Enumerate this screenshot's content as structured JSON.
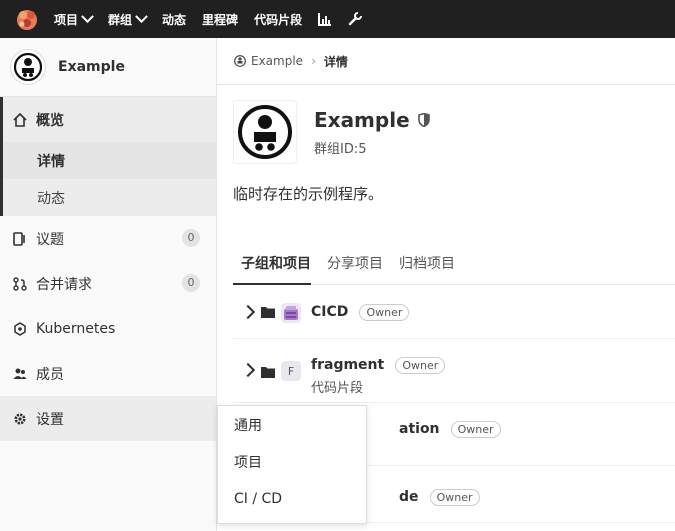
{
  "topnav": {
    "items": [
      {
        "label": "项目",
        "caret": true
      },
      {
        "label": "群组",
        "caret": true
      },
      {
        "label": "动态",
        "caret": false
      },
      {
        "label": "里程碑",
        "caret": false
      },
      {
        "label": "代码片段",
        "caret": false
      }
    ],
    "icons": [
      "chart-icon",
      "wrench-icon"
    ]
  },
  "sidebar": {
    "group_name": "Example",
    "overview_label": "概览",
    "overview_sub": [
      "详情",
      "动态"
    ],
    "items": [
      {
        "label": "议题",
        "icon": "issues-icon",
        "count": "0"
      },
      {
        "label": "合并请求",
        "icon": "merge-request-icon",
        "count": "0"
      },
      {
        "label": "Kubernetes",
        "icon": "kubernetes-icon",
        "count": null
      },
      {
        "label": "成员",
        "icon": "members-icon",
        "count": null
      },
      {
        "label": "设置",
        "icon": "settings-icon",
        "count": null
      }
    ]
  },
  "flyout": {
    "items": [
      "通用",
      "项目",
      "CI / CD"
    ]
  },
  "breadcrumb": {
    "root": "Example",
    "current": "详情"
  },
  "group": {
    "name": "Example",
    "id_text": "群组ID:5",
    "description": "临时存在的示例程序。"
  },
  "tabs": [
    "子组和项目",
    "分享项目",
    "归档项目"
  ],
  "rows": [
    {
      "name": "CICD",
      "role": "Owner",
      "desc": "",
      "avatar": "image"
    },
    {
      "name": "fragment",
      "role": "Owner",
      "desc": "代码片段",
      "avatar": "F"
    },
    {
      "name": "ation",
      "role": "Owner",
      "desc": "",
      "avatar": ""
    },
    {
      "name": "de",
      "role": "Owner",
      "desc": "",
      "avatar": ""
    }
  ],
  "colors": {
    "topbar": "#202020",
    "sidebar": "#fafafa",
    "accent": "#303030"
  }
}
